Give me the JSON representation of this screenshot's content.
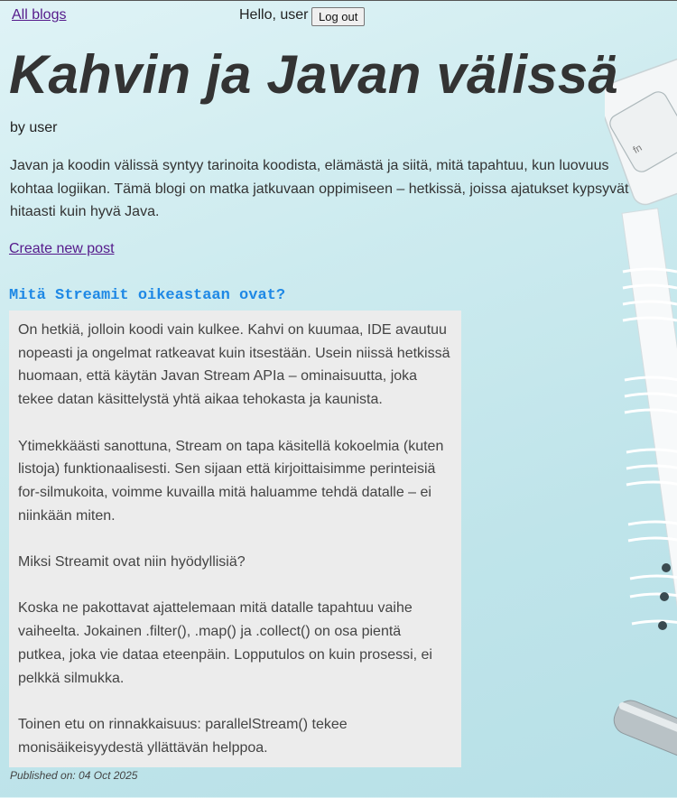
{
  "nav": {
    "all_blogs": "All blogs",
    "greeting": "Hello, user",
    "logout": "Log out"
  },
  "blog": {
    "title": "Kahvin ja Javan välissä",
    "author_line": "by user",
    "description": "Javan ja koodin välissä syntyy tarinoita koodista, elämästä ja siitä, mitä tapahtuu, kun luovuus kohtaa logiikan. Tämä blogi on matka jatkuvaan oppimiseen – hetkissä, joissa ajatukset kypsyvät hitaasti kuin hyvä Java.",
    "create_post": "Create new post"
  },
  "post": {
    "title": "Mitä Streamit oikeastaan ovat?",
    "paragraphs": [
      "On hetkiä, jolloin koodi vain kulkee. Kahvi on kuumaa, IDE avautuu nopeasti ja ongelmat ratkeavat kuin itsestään. Usein niissä hetkissä huomaan, että käytän Javan Stream APIa – ominaisuutta, joka tekee datan käsittelystä yhtä aikaa tehokasta ja kaunista.",
      "Ytimekkäästi sanottuna, Stream on tapa käsitellä kokoelmia (kuten listoja) funktionaalisesti. Sen sijaan että kirjoittaisimme perinteisiä for-silmukoita, voimme kuvailla mitä haluamme tehdä datalle – ei niinkään miten.",
      "Miksi Streamit ovat niin hyödyllisiä?",
      "Koska ne pakottavat ajattelemaan mitä datalle tapahtuu vaihe vaiheelta. Jokainen .filter(), .map() ja .collect() on osa pientä putkea, joka vie dataa eteenpäin. Lopputulos on kuin prosessi, ei pelkkä silmukka.",
      "Toinen etu on rinnakkaisuus: parallelStream() tekee monisäikeisyydestä yllättävän helppoa."
    ],
    "published": "Published on: 04 Oct 2025"
  },
  "colors": {
    "link": "#551a8b",
    "post_title": "#1e88e5",
    "post_background": "#ececec",
    "page_background": "#cdebef"
  },
  "icons": {
    "keyboard": "keyboard-icon",
    "notebook": "spiral-notebook-icon",
    "pen": "pen-icon"
  }
}
